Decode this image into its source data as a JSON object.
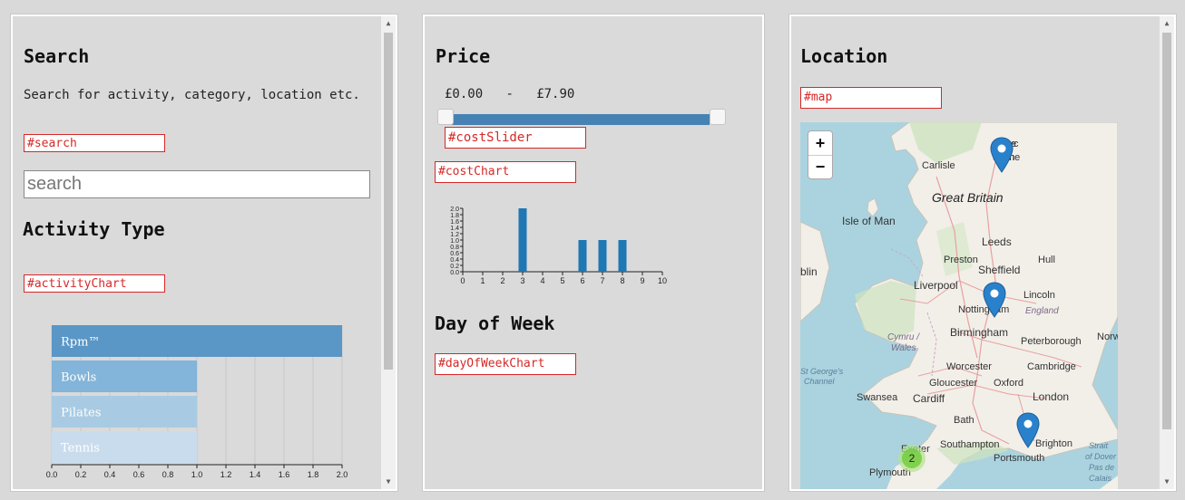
{
  "search_panel": {
    "title": "Search",
    "description": "Search for activity, category, location etc.",
    "search_id_label": "#search",
    "search_placeholder": "search",
    "activity_title": "Activity Type",
    "activity_chart_id_label": "#activityChart"
  },
  "price_panel": {
    "title": "Price",
    "price_min": "£0.00",
    "price_sep": "-",
    "price_max": "£7.90",
    "cost_slider_id_label": "#costSlider",
    "cost_chart_id_label": "#costChart",
    "dow_title": "Day of Week",
    "dow_chart_id_label": "#dayOfWeekChart"
  },
  "location_panel": {
    "title": "Location",
    "map_id_label": "#map",
    "zoom_in": "+",
    "zoom_out": "−",
    "cluster_count": "2",
    "labels": {
      "newcastle_a": "Newc",
      "newcastle_b": "upon",
      "newcastle_c": "e",
      "newcastle_d": "ne",
      "carlisle": "Carlisle",
      "great_britain": "Great Britain",
      "isle_of_man": "Isle of Man",
      "leeds": "Leeds",
      "preston": "Preston",
      "hull": "Hull",
      "sheffield": "Sheffield",
      "blin": "blin",
      "liverpool": "Liverpool",
      "lincoln": "Lincoln",
      "nottingham": "Nottingham",
      "england": "England",
      "birmingham": "Birmingham",
      "peterborough": "Peterborough",
      "norw": "Norw",
      "cymru": "Cymru /",
      "wales": "Wales",
      "worcester": "Worcester",
      "cambridge": "Cambridge",
      "st_georges": "St George's",
      "channel": "Channel",
      "gloucester": "Gloucester",
      "oxford": "Oxford",
      "swansea": "Swansea",
      "cardiff": "Cardiff",
      "london": "London",
      "bath": "Bath",
      "southampton": "Southampton",
      "brighton": "Brighton",
      "exeter": "Exeter",
      "portsmouth": "Portsmouth",
      "plymouth": "Plymouth",
      "strait": "Strait",
      "of_dover": "of Dover /",
      "pas_de": "Pas de",
      "calais": "Calais"
    }
  },
  "colors": {
    "id_box": "#d62828",
    "slider": "#4682b4",
    "bar_primary": "#1f77b4"
  },
  "chart_data": [
    {
      "type": "bar",
      "orientation": "horizontal",
      "categories": [
        "Rpm™",
        "Bowls",
        "Pilates",
        "Tennis"
      ],
      "values": [
        2,
        1,
        1,
        1
      ],
      "colors": [
        "#5a96c6",
        "#83b4d9",
        "#a8cbe3",
        "#c9dcee"
      ],
      "xlim": [
        0,
        2
      ],
      "xticks": [
        "0.0",
        "0.2",
        "0.4",
        "0.6",
        "0.8",
        "1.0",
        "1.2",
        "1.4",
        "1.6",
        "1.8",
        "2.0"
      ],
      "grid": true
    },
    {
      "type": "bar",
      "x": [
        3,
        6,
        7,
        8
      ],
      "values": [
        2,
        1,
        1,
        1
      ],
      "xlim": [
        0,
        10
      ],
      "ylim": [
        0,
        2
      ],
      "xticks": [
        "0",
        "1",
        "2",
        "3",
        "4",
        "5",
        "6",
        "7",
        "8",
        "9",
        "10"
      ],
      "yticks": [
        "0.0",
        "0.2",
        "0.4",
        "0.6",
        "0.8",
        "1.0",
        "1.2",
        "1.4",
        "1.6",
        "1.8",
        "2.0"
      ]
    }
  ]
}
